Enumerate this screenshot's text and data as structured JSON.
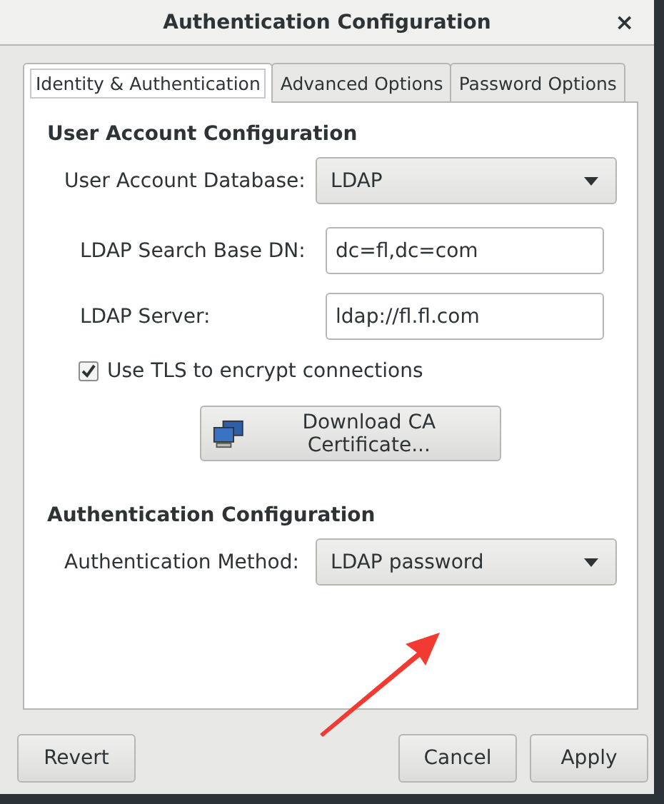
{
  "window": {
    "title": "Authentication Configuration",
    "close": "×"
  },
  "tabs": [
    {
      "label": "Identity & Authentication",
      "selected": true
    },
    {
      "label": "Advanced Options",
      "selected": false
    },
    {
      "label": "Password Options",
      "selected": false
    }
  ],
  "user_account": {
    "heading": "User Account Configuration",
    "database_label": "User Account Database:",
    "database_value": "LDAP",
    "fields": [
      {
        "label": "LDAP Search Base DN:",
        "value": "dc=fl,dc=com"
      },
      {
        "label": "LDAP Server:",
        "value": "ldap://fl.fl.com"
      }
    ],
    "tls": {
      "label": "Use TLS to encrypt connections",
      "checked": true
    },
    "download_button": "Download CA Certificate..."
  },
  "authentication": {
    "heading": "Authentication Configuration",
    "method_label": "Authentication Method:",
    "method_value": "LDAP password"
  },
  "buttons": {
    "left": [
      "Revert"
    ],
    "right": [
      "Cancel",
      "Apply"
    ]
  }
}
